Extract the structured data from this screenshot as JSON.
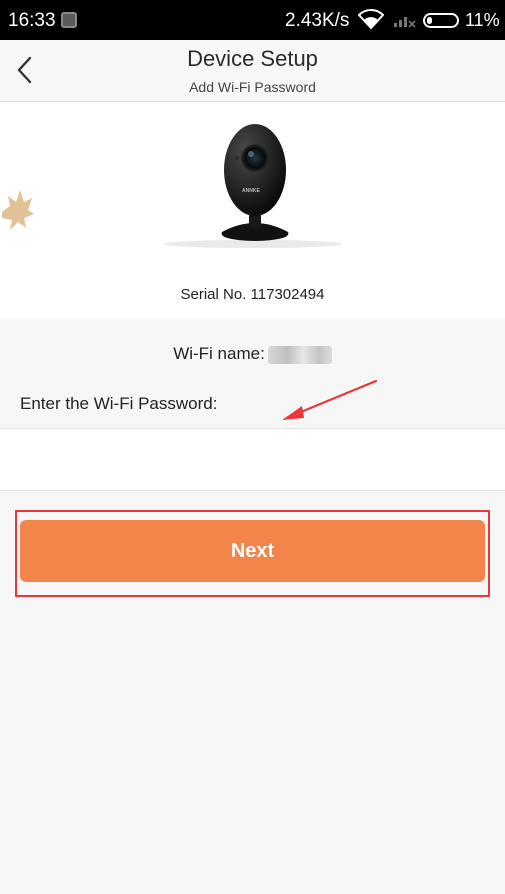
{
  "status_bar": {
    "time": "16:33",
    "network_speed": "2.43K/s",
    "battery_percent": "11%"
  },
  "header": {
    "title": "Device Setup",
    "subtitle": "Add Wi-Fi Password"
  },
  "device": {
    "serial_label": "Serial No. 117302494",
    "camera_brand_mark": "ANNKE"
  },
  "wifi": {
    "name_label": "Wi-Fi name:",
    "password_label": "Enter the Wi-Fi Password:",
    "password_value": ""
  },
  "actions": {
    "next_label": "Next"
  },
  "colors": {
    "accent": "#f3844a",
    "highlight": "#e8383d"
  },
  "icons": [
    "back-arrow-icon",
    "wifi-icon",
    "signal-icon",
    "battery-icon"
  ]
}
